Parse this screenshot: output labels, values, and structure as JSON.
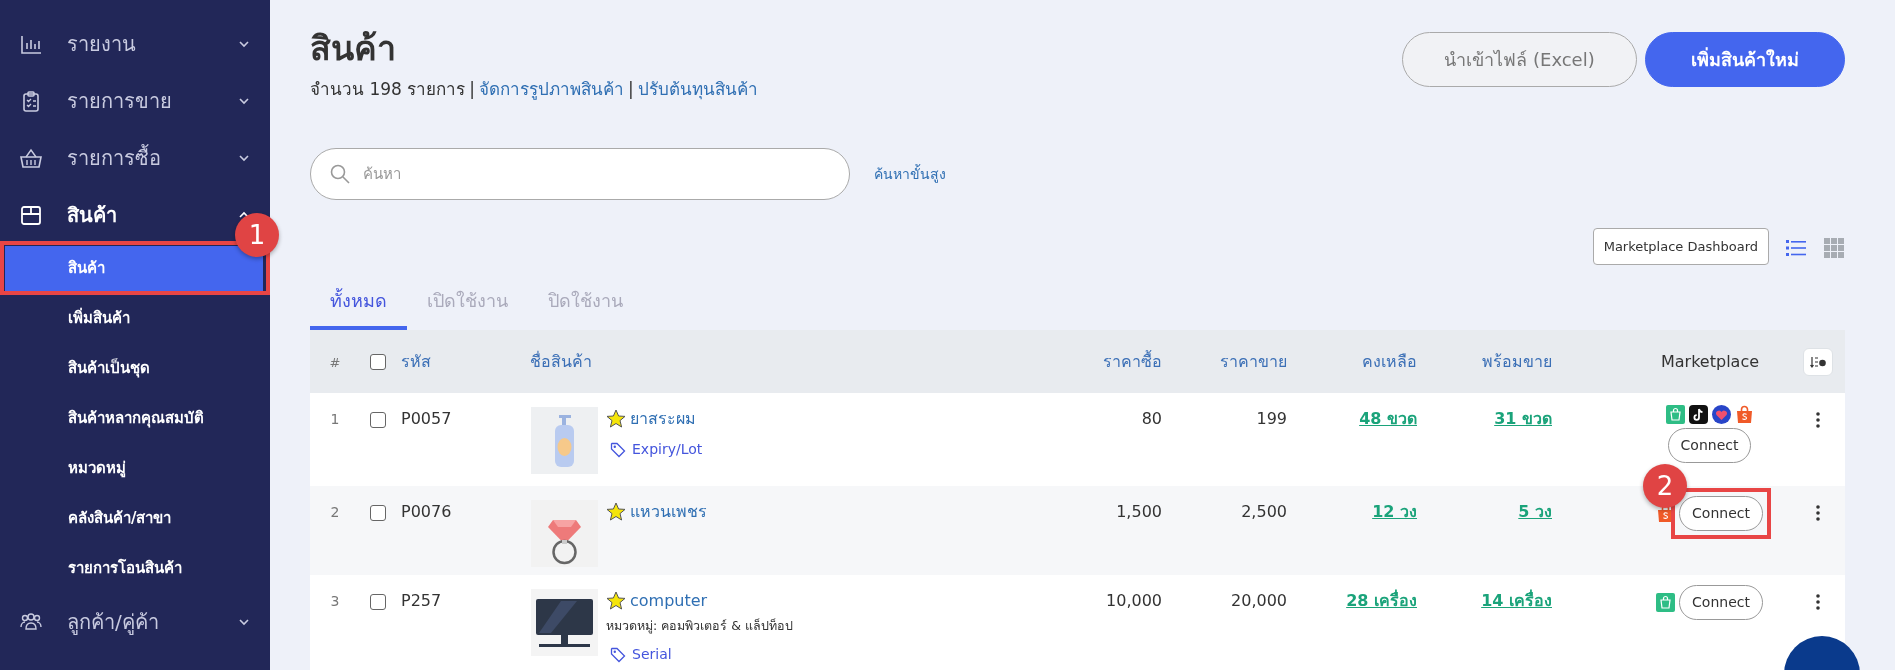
{
  "sidebar": {
    "items": [
      {
        "kind": "chart",
        "label": "รายงาน",
        "expanded": false
      },
      {
        "kind": "clipboard",
        "label": "รายการขาย",
        "expanded": false
      },
      {
        "kind": "basket",
        "label": "รายการซื้อ",
        "expanded": false
      },
      {
        "kind": "box",
        "label": "สินค้า",
        "expanded": true,
        "children": [
          {
            "label": "สินค้า",
            "selected": true,
            "annotation": "1"
          },
          {
            "label": "เพิ่มสินค้า",
            "selected": false
          },
          {
            "label": "สินค้าเป็นชุด",
            "selected": false
          },
          {
            "label": "สินค้าหลากคุณสมบัติ",
            "selected": false
          },
          {
            "label": "หมวดหมู่",
            "selected": false
          },
          {
            "label": "คลังสินค้า/สาขา",
            "selected": false
          },
          {
            "label": "รายการโอนสินค้า",
            "selected": false
          }
        ]
      },
      {
        "kind": "people",
        "label": "ลูกค้า/คู่ค้า",
        "expanded": false
      }
    ]
  },
  "page": {
    "title": "สินค้า",
    "summary": [
      {
        "kind": "text",
        "text": "จำนวน 198 รายการ"
      },
      {
        "kind": "separator",
        "text": "|"
      },
      {
        "kind": "link",
        "text": "จัดการรูปภาพสินค้า"
      },
      {
        "kind": "separator",
        "text": "|"
      },
      {
        "kind": "link",
        "text": "ปรับต้นทุนสินค้า"
      }
    ]
  },
  "header_buttons": [
    {
      "label": "นำเข้าไฟล์ (Excel)",
      "kind": "secondary"
    },
    {
      "label": "เพิ่มสินค้าใหม่",
      "kind": "primary"
    }
  ],
  "search": {
    "placeholder": "ค้นหา",
    "advanced_link": "ค้นหาขั้นสูง"
  },
  "toolbar": {
    "dashboard_button": "Marketplace Dashboard",
    "views": [
      {
        "kind": "list",
        "selected": true
      },
      {
        "kind": "grid",
        "selected": false
      }
    ]
  },
  "tabs": [
    {
      "label": "ทั้งหมด",
      "selected": true
    },
    {
      "label": "เปิดใช้งาน",
      "selected": false
    },
    {
      "label": "ปิดใช้งาน",
      "selected": false
    }
  ],
  "table": {
    "columns": [
      "#",
      "รหัส",
      "ชื่อสินค้า",
      "ราคาซื้อ",
      "ราคาขาย",
      "คงเหลือ",
      "พร้อมขาย",
      "Marketplace"
    ],
    "select_all_checked": false,
    "rows": [
      {
        "index": "1",
        "checked": false,
        "code": "P0057",
        "thumbnail": {
          "kind": "picture"
        },
        "name": "ยาสระผม",
        "tag": "Expiry/Lot",
        "cost": "80",
        "price": "199",
        "stock": "48 ขวด",
        "available": "31 ขวด",
        "channels": [
          {
            "kind": "bag"
          },
          {
            "kind": "tiktok"
          },
          {
            "kind": "lazada"
          },
          {
            "kind": "shopee"
          }
        ],
        "connect": "Connect"
      },
      {
        "index": "2",
        "checked": false,
        "code": "P0076",
        "thumbnail": {
          "kind": "picture"
        },
        "name": "แหวนเพชร",
        "cost": "1,500",
        "price": "2,500",
        "stock": "12 วง",
        "available": "5 วง",
        "channels": [
          {
            "kind": "shopee"
          }
        ],
        "connect": "Connect",
        "annotation": "2"
      },
      {
        "index": "3",
        "checked": false,
        "code": "P257",
        "thumbnail": {
          "kind": "picture"
        },
        "name": "computer",
        "category": "หมวดหมู่: คอมพิวเตอร์ & แล็ปท็อป",
        "tag": "Serial",
        "cost": "10,000",
        "price": "20,000",
        "stock": "28 เครื่อง",
        "available": "14 เครื่อง",
        "channels": [
          {
            "kind": "bag"
          }
        ],
        "connect": "Connect"
      }
    ]
  }
}
